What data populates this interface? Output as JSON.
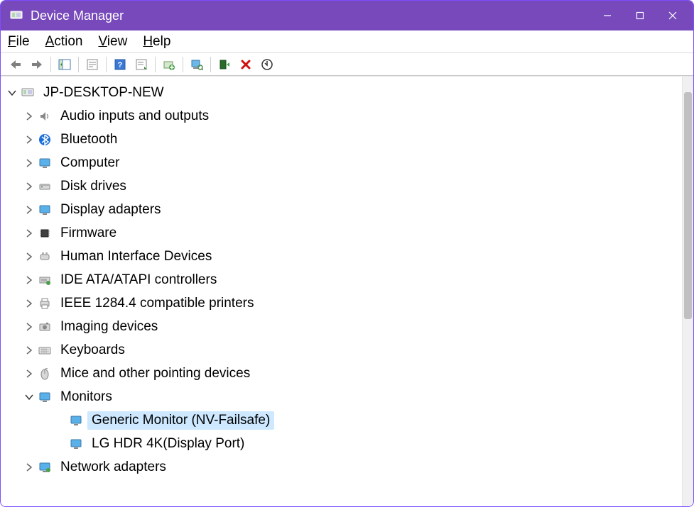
{
  "window": {
    "title": "Device Manager"
  },
  "menu": {
    "file": "File",
    "action": "Action",
    "view": "View",
    "help": "Help"
  },
  "tree": {
    "root": "JP-DESKTOP-NEW",
    "categories": [
      {
        "label": "Audio inputs and outputs",
        "icon": "speaker"
      },
      {
        "label": "Bluetooth",
        "icon": "bluetooth"
      },
      {
        "label": "Computer",
        "icon": "monitor"
      },
      {
        "label": "Disk drives",
        "icon": "disk"
      },
      {
        "label": "Display adapters",
        "icon": "monitor"
      },
      {
        "label": "Firmware",
        "icon": "chip"
      },
      {
        "label": "Human Interface Devices",
        "icon": "hid"
      },
      {
        "label": "IDE ATA/ATAPI controllers",
        "icon": "ide"
      },
      {
        "label": "IEEE 1284.4 compatible printers",
        "icon": "printer"
      },
      {
        "label": "Imaging devices",
        "icon": "camera"
      },
      {
        "label": "Keyboards",
        "icon": "keyboard"
      },
      {
        "label": "Mice and other pointing devices",
        "icon": "mouse"
      },
      {
        "label": "Monitors",
        "icon": "monitor",
        "expanded": true,
        "children": [
          {
            "label": "Generic Monitor (NV-Failsafe)",
            "icon": "monitor",
            "selected": true
          },
          {
            "label": "LG HDR 4K(Display Port)",
            "icon": "monitor"
          }
        ]
      },
      {
        "label": "Network adapters",
        "icon": "monitor-net"
      }
    ]
  }
}
